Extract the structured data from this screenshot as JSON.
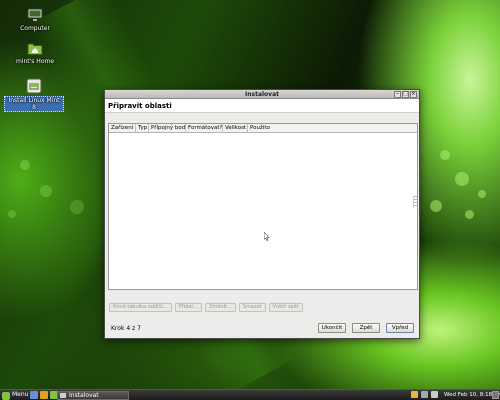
{
  "desktop": {
    "icons": [
      {
        "label": "Computer",
        "icon": "computer-icon"
      },
      {
        "label": "mint's Home",
        "icon": "home-folder-icon"
      },
      {
        "label": "Install Linux Mint 8",
        "icon": "install-disc-icon"
      }
    ]
  },
  "window": {
    "title": "Instalovat",
    "controls": [
      "minimize",
      "maximize",
      "close"
    ],
    "heading": "Připravit oblasti",
    "columns": [
      "Zařízení",
      "Typ",
      "Přípojný bod",
      "Formátovat?",
      "Velikost",
      "Použito"
    ],
    "rows": [],
    "partition_buttons": [
      "Nová tabulka oddílů...",
      "Přidat...",
      "Změnit...",
      "Smazat",
      "Vrátit zpět"
    ],
    "step_text": "Krok 4 z 7",
    "buttons": {
      "quit": "Ukončit",
      "back": "Zpět",
      "forward": "Vpřed"
    }
  },
  "taskbar": {
    "menu_label": "Menu",
    "task_label": "Instalovat",
    "clock": "Wed Feb 10,  8:18 AM"
  },
  "colors": {
    "accent_green": "#7ec43e",
    "selection_blue": "#3b6fb0"
  }
}
